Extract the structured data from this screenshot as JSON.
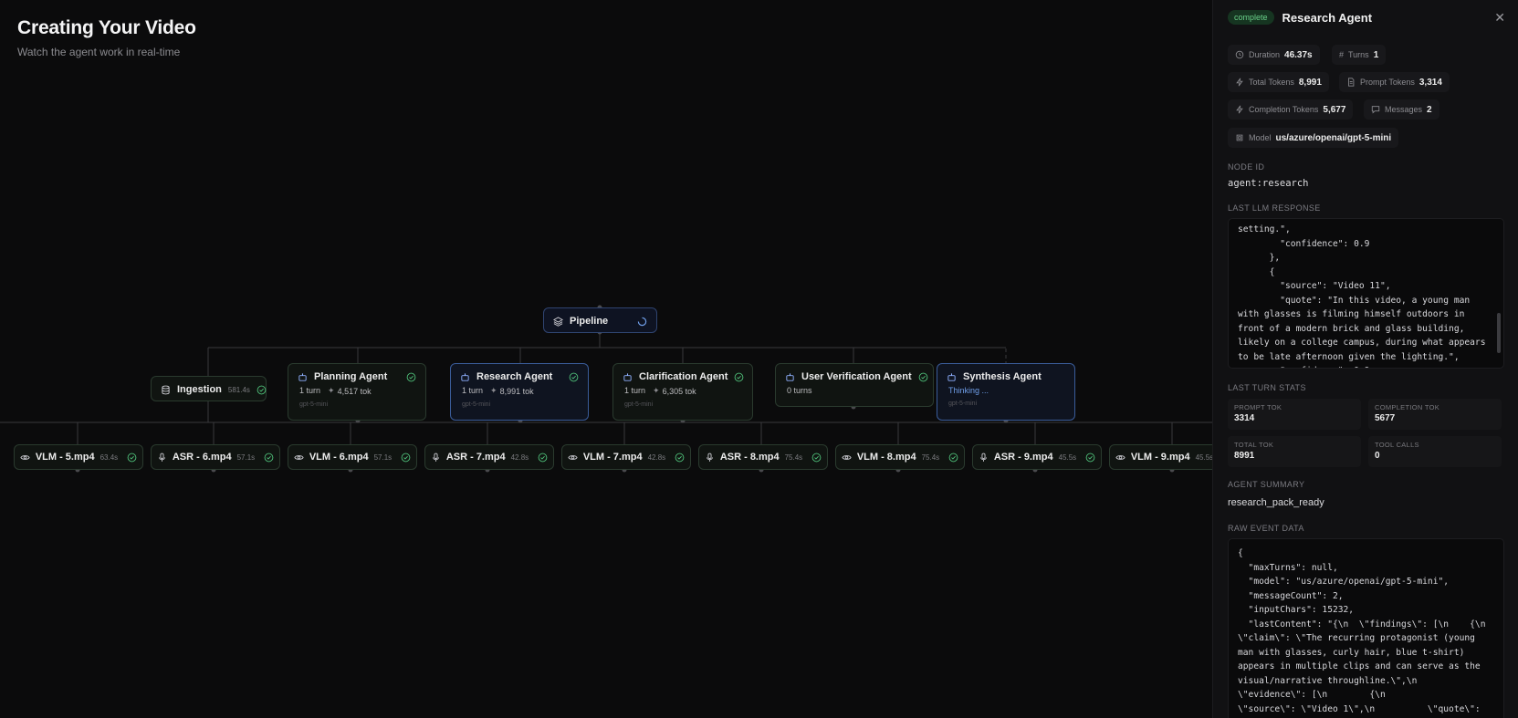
{
  "page": {
    "title": "Creating Your Video",
    "subtitle": "Watch the agent work in real-time"
  },
  "graph": {
    "pipeline": {
      "label": "Pipeline"
    },
    "ingestion": {
      "label": "Ingestion",
      "time": "581.4s"
    },
    "agents": [
      {
        "label": "Planning Agent",
        "turns": "1 turn",
        "tokens": "4,517 tok",
        "model": "gpt-5-mini",
        "status": "complete"
      },
      {
        "label": "Research Agent",
        "turns": "1 turn",
        "tokens": "8,991 tok",
        "model": "gpt-5-mini",
        "status": "complete"
      },
      {
        "label": "Clarification Agent",
        "turns": "1 turn",
        "tokens": "6,305 tok",
        "model": "gpt-5-mini",
        "status": "complete"
      },
      {
        "label": "User Verification Agent",
        "turns": "0 turns",
        "tokens": "",
        "model": "",
        "status": "complete"
      },
      {
        "label": "Synthesis Agent",
        "turns": "Thinking ...",
        "tokens": "",
        "model": "gpt-5-mini",
        "status": "running"
      }
    ],
    "leaves": [
      {
        "label": "VLM - 5.mp4",
        "time": "63.4s",
        "kind": "vlm"
      },
      {
        "label": "ASR - 6.mp4",
        "time": "57.1s",
        "kind": "asr"
      },
      {
        "label": "VLM - 6.mp4",
        "time": "57.1s",
        "kind": "vlm"
      },
      {
        "label": "ASR - 7.mp4",
        "time": "42.8s",
        "kind": "asr"
      },
      {
        "label": "VLM - 7.mp4",
        "time": "42.8s",
        "kind": "vlm"
      },
      {
        "label": "ASR - 8.mp4",
        "time": "75.4s",
        "kind": "asr"
      },
      {
        "label": "VLM - 8.mp4",
        "time": "75.4s",
        "kind": "vlm"
      },
      {
        "label": "ASR - 9.mp4",
        "time": "45.5s",
        "kind": "asr"
      },
      {
        "label": "VLM - 9.mp4",
        "time": "45.5s",
        "kind": "vlm"
      }
    ]
  },
  "panel": {
    "badge": "complete",
    "title": "Research Agent",
    "chips": {
      "duration": {
        "label": "Duration",
        "value": "46.37s"
      },
      "turns": {
        "label": "Turns",
        "value": "1"
      },
      "total_tokens": {
        "label": "Total Tokens",
        "value": "8,991"
      },
      "prompt_tokens": {
        "label": "Prompt Tokens",
        "value": "3,314"
      },
      "completion_tokens": {
        "label": "Completion Tokens",
        "value": "5,677"
      },
      "messages": {
        "label": "Messages",
        "value": "2"
      },
      "model": {
        "label": "Model",
        "value": "us/azure/openai/gpt-5-mini"
      }
    },
    "node_id_label": "NODE ID",
    "node_id": "agent:research",
    "last_response_label": "LAST LLM RESPONSE",
    "last_response": "setting.\",\n        \"confidence\": 0.9\n      },\n      {\n        \"source\": \"Video 11\",\n        \"quote\": \"In this video, a young man\nwith glasses is filming himself outdoors in\nfront of a modern brick and glass building,\nlikely on a college campus, during what appears\nto be late afternoon given the lighting.\",\n        \"confidence\": 0.9",
    "turn_stats_label": "LAST TURN STATS",
    "stats": [
      {
        "label": "PROMPT TOK",
        "value": "3314"
      },
      {
        "label": "COMPLETION TOK",
        "value": "5677"
      },
      {
        "label": "TOTAL TOK",
        "value": "8991"
      },
      {
        "label": "TOOL CALLS",
        "value": "0"
      }
    ],
    "summary_label": "AGENT SUMMARY",
    "summary": "research_pack_ready",
    "raw_label": "RAW EVENT DATA",
    "raw": "{\n  \"maxTurns\": null,\n  \"model\": \"us/azure/openai/gpt-5-mini\",\n  \"messageCount\": 2,\n  \"inputChars\": 15232,\n  \"lastContent\": \"{\\n  \\\"findings\\\": [\\n    {\\n\n\\\"claim\\\": \\\"The recurring protagonist (young\nman with glasses, curly hair, blue t-shirt)\nappears in multiple clips and can serve as the\nvisual/narrative throughline.\\\",\\n\n\\\"evidence\\\": [\\n        {\\n\n\\\"source\\\": \\\"Video 1\\\",\\n          \\\"quote\\\":"
  },
  "colors": {
    "accent_blue": "#3a5c9a",
    "success_green": "#4fc17a",
    "running_blue": "#6f9ee8"
  }
}
